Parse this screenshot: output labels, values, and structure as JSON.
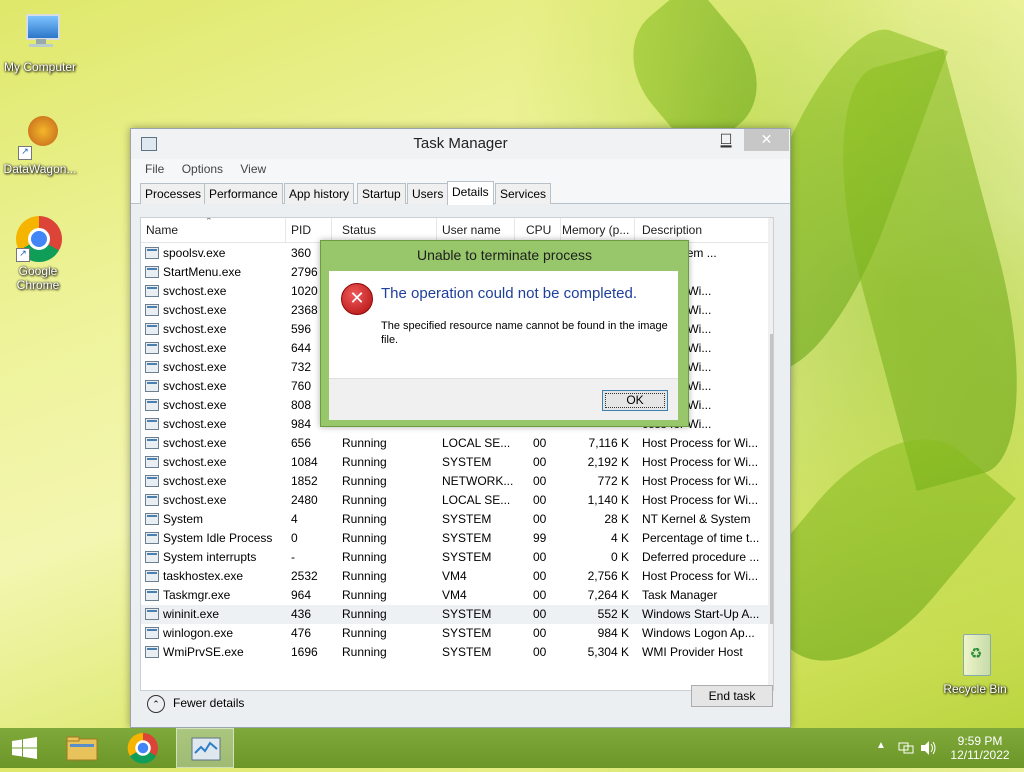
{
  "desktop": {
    "icons": [
      {
        "label": "My Computer"
      },
      {
        "label": "DataWagon..."
      },
      {
        "label": "Google Chrome"
      },
      {
        "label": "Recycle Bin"
      }
    ]
  },
  "task_manager": {
    "title": "Task Manager",
    "menu": [
      "File",
      "Options",
      "View"
    ],
    "tabs": [
      "Processes",
      "Performance",
      "App history",
      "Startup",
      "Users",
      "Details",
      "Services"
    ],
    "active_tab": "Details",
    "columns": [
      "Name",
      "PID",
      "Status",
      "User name",
      "CPU",
      "Memory (p...",
      "Description"
    ],
    "rows": [
      {
        "name": "spoolsv.exe",
        "pid": "360",
        "status": "",
        "user": "",
        "cpu": "",
        "mem": "",
        "desc": "SubSystem ..."
      },
      {
        "name": "StartMenu.exe",
        "pid": "2796",
        "status": "",
        "user": "",
        "cpu": "",
        "mem": "",
        "desc": "ell Menu"
      },
      {
        "name": "svchost.exe",
        "pid": "1020",
        "status": "",
        "user": "",
        "cpu": "",
        "mem": "",
        "desc": "cess for Wi..."
      },
      {
        "name": "svchost.exe",
        "pid": "2368",
        "status": "",
        "user": "",
        "cpu": "",
        "mem": "",
        "desc": "cess for Wi..."
      },
      {
        "name": "svchost.exe",
        "pid": "596",
        "status": "",
        "user": "",
        "cpu": "",
        "mem": "",
        "desc": "cess for Wi..."
      },
      {
        "name": "svchost.exe",
        "pid": "644",
        "status": "",
        "user": "",
        "cpu": "",
        "mem": "",
        "desc": "cess for Wi..."
      },
      {
        "name": "svchost.exe",
        "pid": "732",
        "status": "",
        "user": "",
        "cpu": "",
        "mem": "",
        "desc": "cess for Wi..."
      },
      {
        "name": "svchost.exe",
        "pid": "760",
        "status": "",
        "user": "",
        "cpu": "",
        "mem": "",
        "desc": "cess for Wi..."
      },
      {
        "name": "svchost.exe",
        "pid": "808",
        "status": "",
        "user": "",
        "cpu": "",
        "mem": "",
        "desc": "cess for Wi..."
      },
      {
        "name": "svchost.exe",
        "pid": "984",
        "status": "",
        "user": "",
        "cpu": "",
        "mem": "",
        "desc": "cess for Wi..."
      },
      {
        "name": "svchost.exe",
        "pid": "656",
        "status": "Running",
        "user": "LOCAL SE...",
        "cpu": "00",
        "mem": "7,116 K",
        "desc": "Host Process for Wi..."
      },
      {
        "name": "svchost.exe",
        "pid": "1084",
        "status": "Running",
        "user": "SYSTEM",
        "cpu": "00",
        "mem": "2,192 K",
        "desc": "Host Process for Wi..."
      },
      {
        "name": "svchost.exe",
        "pid": "1852",
        "status": "Running",
        "user": "NETWORK...",
        "cpu": "00",
        "mem": "772 K",
        "desc": "Host Process for Wi..."
      },
      {
        "name": "svchost.exe",
        "pid": "2480",
        "status": "Running",
        "user": "LOCAL SE...",
        "cpu": "00",
        "mem": "1,140 K",
        "desc": "Host Process for Wi..."
      },
      {
        "name": "System",
        "pid": "4",
        "status": "Running",
        "user": "SYSTEM",
        "cpu": "00",
        "mem": "28 K",
        "desc": "NT Kernel & System"
      },
      {
        "name": "System Idle Process",
        "pid": "0",
        "status": "Running",
        "user": "SYSTEM",
        "cpu": "99",
        "mem": "4 K",
        "desc": "Percentage of time t..."
      },
      {
        "name": "System interrupts",
        "pid": "-",
        "status": "Running",
        "user": "SYSTEM",
        "cpu": "00",
        "mem": "0 K",
        "desc": "Deferred procedure ..."
      },
      {
        "name": "taskhostex.exe",
        "pid": "2532",
        "status": "Running",
        "user": "VM4",
        "cpu": "00",
        "mem": "2,756 K",
        "desc": "Host Process for Wi..."
      },
      {
        "name": "Taskmgr.exe",
        "pid": "964",
        "status": "Running",
        "user": "VM4",
        "cpu": "00",
        "mem": "7,264 K",
        "desc": "Task Manager"
      },
      {
        "name": "wininit.exe",
        "pid": "436",
        "status": "Running",
        "user": "SYSTEM",
        "cpu": "00",
        "mem": "552 K",
        "desc": "Windows Start-Up A..."
      },
      {
        "name": "winlogon.exe",
        "pid": "476",
        "status": "Running",
        "user": "SYSTEM",
        "cpu": "00",
        "mem": "984 K",
        "desc": "Windows Logon Ap..."
      },
      {
        "name": "WmiPrvSE.exe",
        "pid": "1696",
        "status": "Running",
        "user": "SYSTEM",
        "cpu": "00",
        "mem": "5,304 K",
        "desc": "WMI Provider Host"
      }
    ],
    "selected_row": "wininit.exe",
    "fewer_details": "Fewer details",
    "end_task": "End task"
  },
  "dialog": {
    "title": "Unable to terminate process",
    "main_instruction": "The operation could not be completed.",
    "detail": "The specified resource name cannot be found in the image file.",
    "ok": "OK"
  },
  "taskbar": {
    "time": "9:59 PM",
    "date": "12/11/2022",
    "accent": "#7ba536"
  }
}
